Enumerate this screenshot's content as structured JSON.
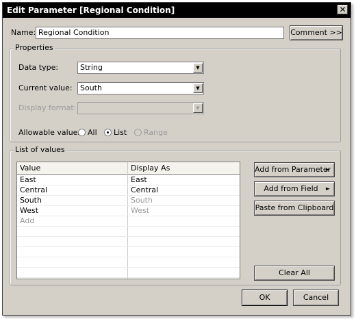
{
  "window": {
    "title": "Edit Parameter [Regional Condition]",
    "close_glyph": "✕"
  },
  "name": {
    "label": "Name:",
    "value": "Regional Condition",
    "comment_button": "Comment >>"
  },
  "properties": {
    "title": "Properties",
    "data_type": {
      "label": "Data type:",
      "value": "String"
    },
    "current_value": {
      "label": "Current value:",
      "value": "South"
    },
    "display_format": {
      "label": "Display format:",
      "value": ""
    },
    "allowable": {
      "label": "Allowable values:",
      "options": [
        "All",
        "List",
        "Range"
      ],
      "selected": "List"
    }
  },
  "list_of_values": {
    "title": "List of values",
    "columns": [
      "Value",
      "Display As"
    ],
    "rows": [
      {
        "value": "East",
        "display": "East",
        "display_muted": false
      },
      {
        "value": "Central",
        "display": "Central",
        "display_muted": false
      },
      {
        "value": "South",
        "display": "South",
        "display_muted": true
      },
      {
        "value": "West",
        "display": "West",
        "display_muted": true
      }
    ],
    "add_placeholder": "Add",
    "buttons": {
      "add_from_parameter": "Add from Parameter",
      "add_from_field": "Add from Field",
      "paste_from_clipboard": "Paste from Clipboard",
      "clear_all": "Clear All"
    }
  },
  "footer": {
    "ok": "OK",
    "cancel": "Cancel"
  },
  "icons": {
    "dropdown": "chevron-down-icon",
    "submenu": "chevron-right-icon"
  },
  "colors": {
    "titlebar": "#000000",
    "dialog_bg": "#d4d0c8",
    "muted_text": "#9a9a9a"
  }
}
